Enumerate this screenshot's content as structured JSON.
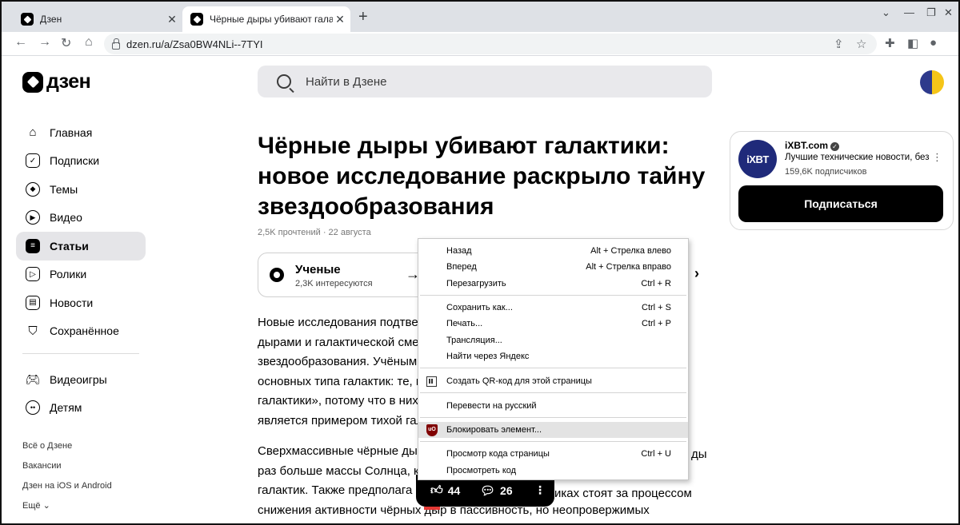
{
  "browser": {
    "tabs": [
      {
        "title": "Дзен",
        "active": false
      },
      {
        "title": "Чёрные дыры убивают галакти",
        "active": true
      }
    ],
    "new_tab_glyph": "+",
    "url": "dzen.ru/a/Zsa0BW4NLi--7TYI"
  },
  "site": {
    "logo_text": "дзен",
    "search_placeholder": "Найти в Дзене"
  },
  "sidebar": {
    "items": [
      {
        "label": "Главная",
        "icon": "home-icon"
      },
      {
        "label": "Подписки",
        "icon": "subscriptions-icon"
      },
      {
        "label": "Темы",
        "icon": "compass-icon"
      },
      {
        "label": "Видео",
        "icon": "video-icon"
      },
      {
        "label": "Статьи",
        "icon": "articles-icon",
        "active": true
      },
      {
        "label": "Ролики",
        "icon": "clips-icon"
      },
      {
        "label": "Новости",
        "icon": "news-icon"
      },
      {
        "label": "Сохранённое",
        "icon": "bookmark-icon"
      }
    ],
    "items2": [
      {
        "label": "Видеоигры",
        "icon": "gamepad-icon"
      },
      {
        "label": "Детям",
        "icon": "kids-icon"
      }
    ],
    "footer": [
      "Всё о Дзене",
      "Вакансии",
      "Дзен на iOS и Android",
      "Ещё"
    ]
  },
  "article": {
    "title": "Чёрные дыры убивают галактики: новое исследование раскрыло тайну звездообразования",
    "meta": "2,5K прочтений · 22 августа",
    "topic": {
      "name": "Ученые",
      "followers": "2,3K интересуются"
    },
    "p1": [
      "Новые исследования подтвер",
      "дырами и галактической смер",
      "звездообразования. Учёным",
      "основных типа галактик: те, в",
      "галактики», потому что в них",
      "является примером тихой гал"
    ],
    "p2": [
      "Сверхмассивные чёрные дыр",
      "раз больше массы Солнца, к",
      "галактик. Также предполага",
      "снижения активности чёрных дыр в пассивность, но неопровержимых"
    ],
    "p2_tail_a": "ды",
    "p2_tail_c": "иках стоят за процессом",
    "likes": "44",
    "comments": "26"
  },
  "channel": {
    "name": "iXBT.com",
    "logo_text": "iXBT",
    "description": "Лучшие технические новости, без...",
    "subscribers": "159,6K подписчиков",
    "subscribe_label": "Подписаться"
  },
  "context_menu": {
    "items": [
      {
        "label": "Назад",
        "shortcut": "Alt + Стрелка влево"
      },
      {
        "label": "Вперед",
        "shortcut": "Alt + Стрелка вправо"
      },
      {
        "label": "Перезагрузить",
        "shortcut": "Ctrl + R"
      },
      {
        "label": "Сохранить как...",
        "shortcut": "Ctrl + S"
      },
      {
        "label": "Печать...",
        "shortcut": "Ctrl + P"
      },
      {
        "label": "Трансляция...",
        "shortcut": ""
      },
      {
        "label": "Найти через Яндекс",
        "shortcut": ""
      },
      {
        "label": "Создать QR-код для этой страницы",
        "shortcut": ""
      },
      {
        "label": "Перевести на русский",
        "shortcut": ""
      },
      {
        "label": "Блокировать элемент...",
        "shortcut": "",
        "highlighted": true
      },
      {
        "label": "Просмотр кода страницы",
        "shortcut": "Ctrl + U"
      },
      {
        "label": "Просмотреть код",
        "shortcut": ""
      }
    ]
  },
  "colors": {
    "accent": "#000000",
    "active_nav_bg": "#e5e5e8",
    "menu_highlight": "#e3e3e3"
  }
}
